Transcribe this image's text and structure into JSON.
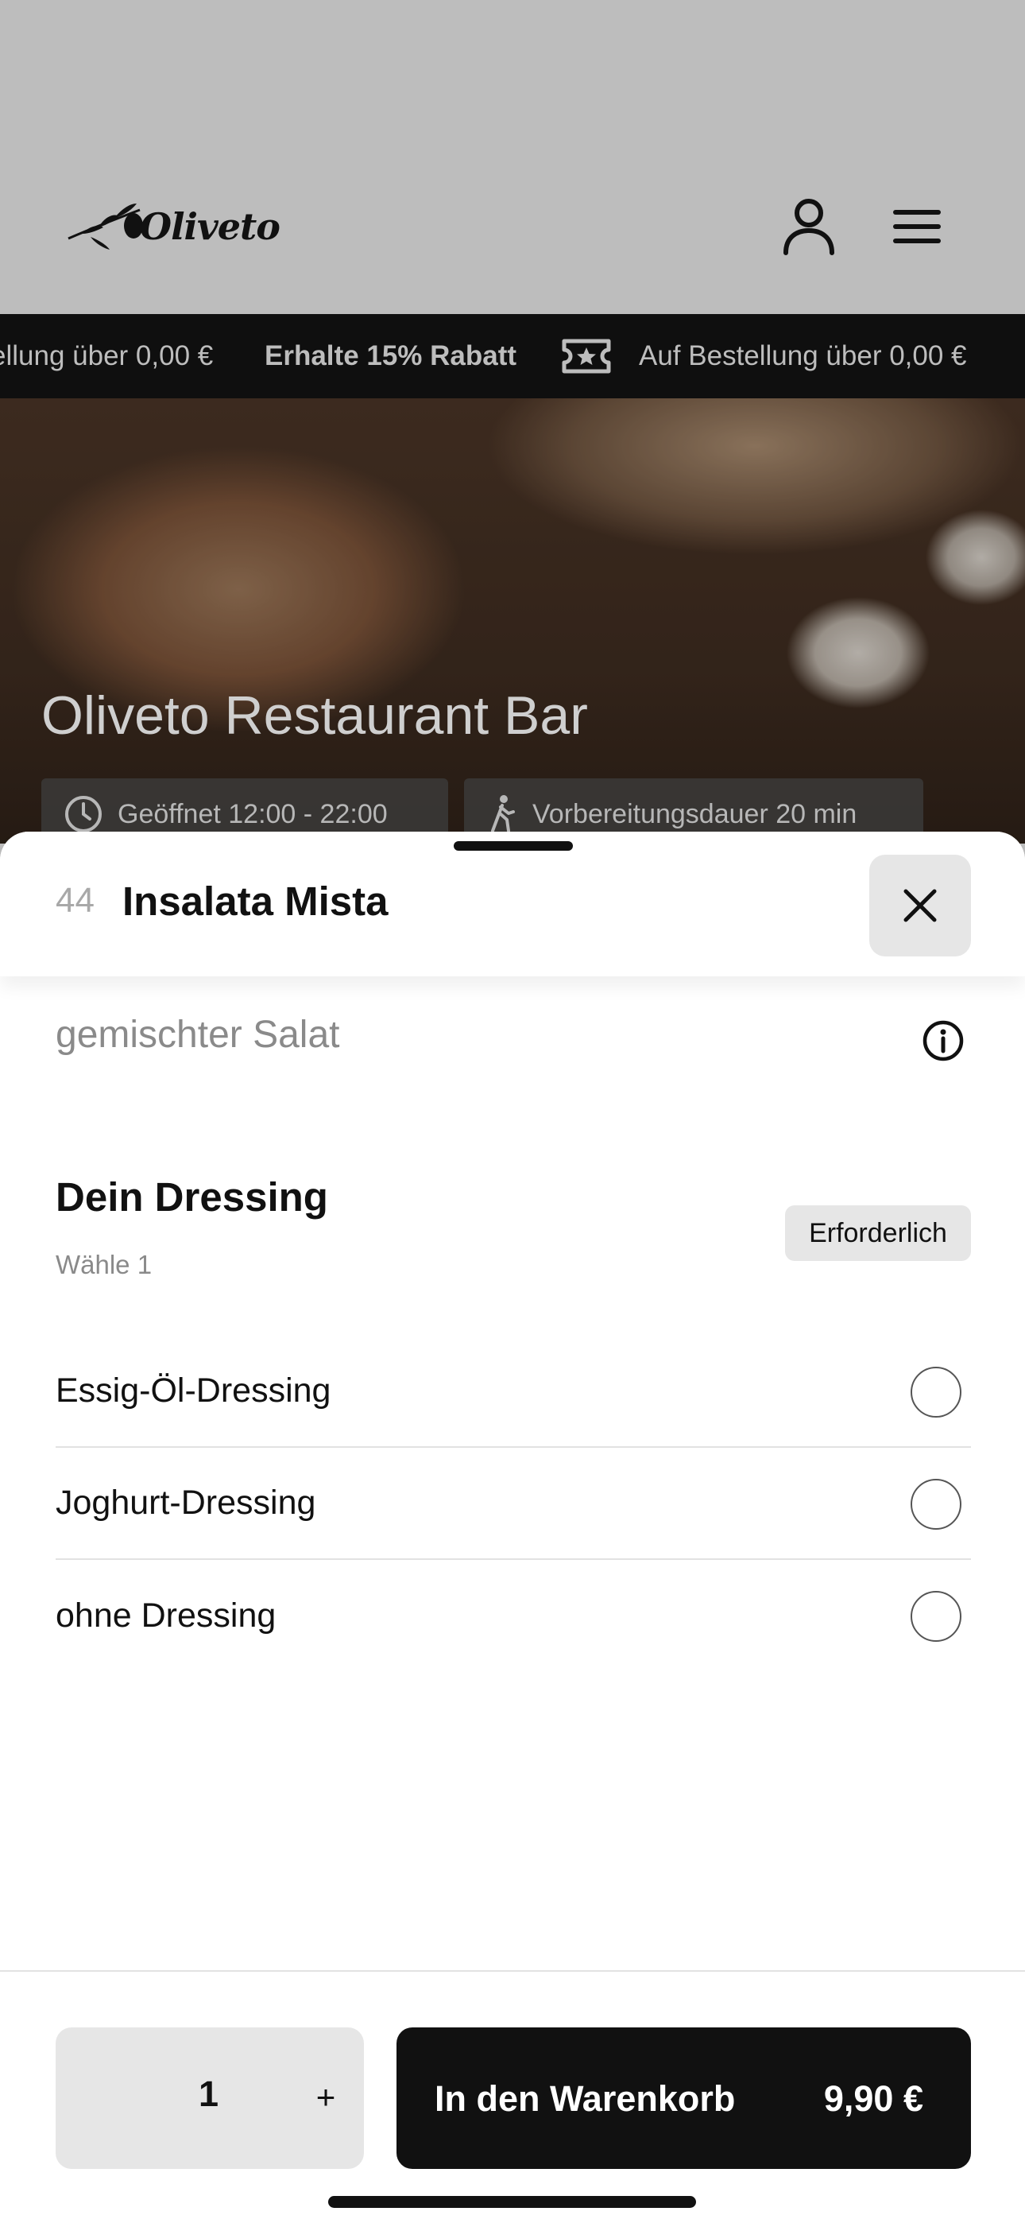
{
  "header": {
    "logo_text": "Oliveto",
    "user_icon": "user-icon",
    "menu_icon": "menu-icon"
  },
  "ticker": {
    "left_text": "ellung über 0,00 €",
    "promo_text": "Erhalte 15% Rabatt",
    "right_text": "Auf Bestellung über 0,00 €",
    "ticket_icon": "ticket-icon"
  },
  "hero": {
    "title": "Oliveto Restaurant Bar",
    "hours": "Geöffnet 12:00 - 22:00",
    "prep_time": "Vorbereitungsdauer 20 min"
  },
  "sheet": {
    "item_number": "44",
    "item_title": "Insalata Mista",
    "close_icon": "close-icon",
    "description": "gemischter Salat",
    "info_icon": "info-icon",
    "group": {
      "title": "Dein Dressing",
      "subtitle": "Wähle 1",
      "badge": "Erforderlich",
      "options": [
        {
          "label": "Essig-Öl-Dressing",
          "selected": false
        },
        {
          "label": "Joghurt-Dressing",
          "selected": false
        },
        {
          "label": "ohne Dressing",
          "selected": false
        }
      ]
    },
    "footer": {
      "quantity": "1",
      "plus_label": "+",
      "cart_label": "In den Warenkorb",
      "price": "9,90 €"
    }
  },
  "colors": {
    "dim_background": "#bdbdbd",
    "ticker_bg": "#0f0f0f",
    "primary_button": "#111111",
    "secondary_surface": "#e6e6e6"
  }
}
